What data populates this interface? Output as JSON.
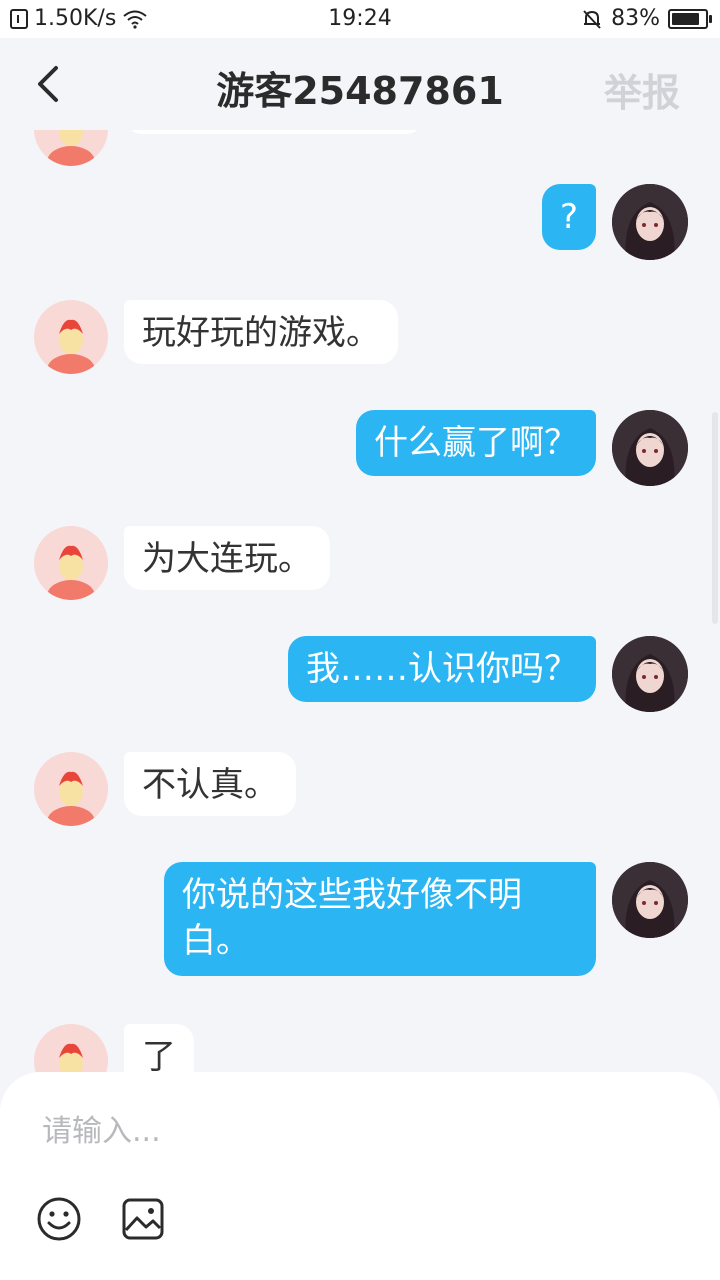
{
  "status_bar": {
    "speed": "1.50K/s",
    "time": "19:24",
    "battery": "83%",
    "battery_level": 0.83
  },
  "header": {
    "title": "游客25487861",
    "report_label": "举报"
  },
  "messages": {
    "m0": {
      "side": "in",
      "text": ""
    },
    "m1": {
      "side": "out",
      "text": "?"
    },
    "m2": {
      "side": "in",
      "text": "玩好玩的游戏。"
    },
    "m3": {
      "side": "out",
      "text": "什么赢了啊？"
    },
    "m4": {
      "side": "in",
      "text": "为大连玩。"
    },
    "m5": {
      "side": "out",
      "text": "我……认识你吗？"
    },
    "m6": {
      "side": "in",
      "text": "不认真。"
    },
    "m7": {
      "side": "out",
      "text": "你说的这些我好像不明白。"
    },
    "m8": {
      "side": "in",
      "text": "了"
    }
  },
  "composer": {
    "placeholder": "请输入..."
  },
  "colors": {
    "bubble_out": "#2bb5f3",
    "bubble_in": "#ffffff",
    "background": "#f3f5f8",
    "report": "#cfd3d8"
  }
}
